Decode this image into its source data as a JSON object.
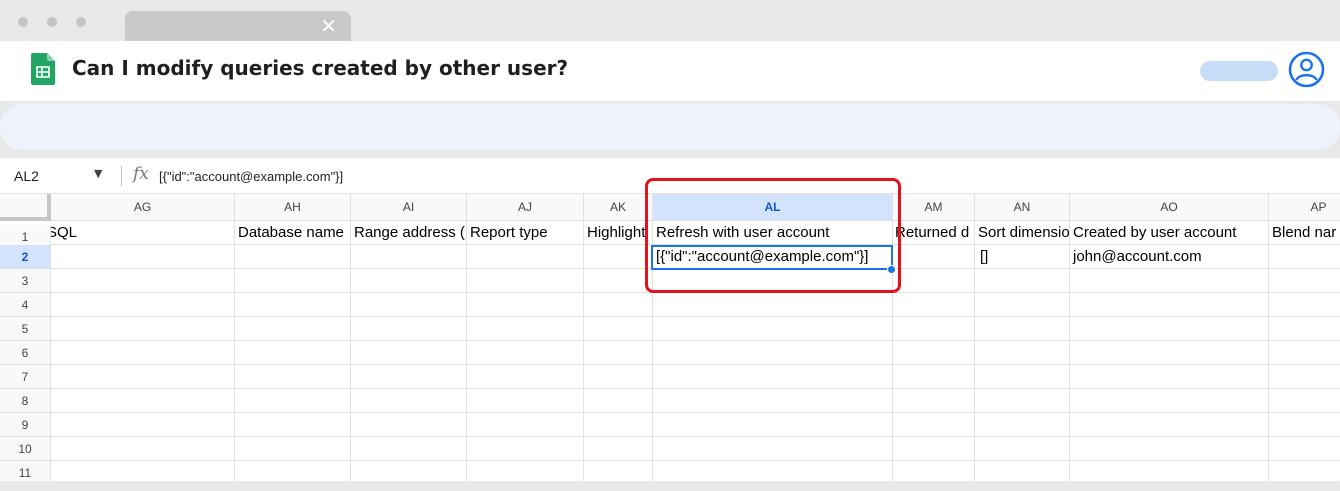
{
  "window": {
    "tab_close_glyph": "✕"
  },
  "header": {
    "title": "Can I modify queries created by other user?",
    "app_icon": "google-sheets-icon",
    "profile_icon": "account-circle-icon",
    "brand_color": "#23a566",
    "accent_color": "#1a73e8"
  },
  "formula_bar": {
    "cell_ref": "AL2",
    "fx_label": "fx",
    "value": "[{\"id\":\"account@example.com\"}]"
  },
  "grid": {
    "columns": [
      "AG",
      "AH",
      "AI",
      "AJ",
      "AK",
      "AL",
      "AM",
      "AN",
      "AO",
      "AP"
    ],
    "active_column": "AL",
    "rows": [
      "1",
      "2",
      "3",
      "4",
      "5",
      "6",
      "7",
      "8",
      "9",
      "10",
      "11"
    ],
    "active_row": "2",
    "row1": [
      "SQL",
      "Database name",
      "Range address (",
      "Report type",
      "Highlight",
      "Refresh with user account",
      "Returned d",
      "Sort dimensio",
      "Created by user account",
      "Blend nar"
    ],
    "row2": [
      "",
      "",
      "",
      "",
      "",
      "[{\"id\":\"account@example.com\"}]",
      "",
      "[]",
      "john@account.com",
      ""
    ]
  },
  "highlight_color": "#e3121c"
}
